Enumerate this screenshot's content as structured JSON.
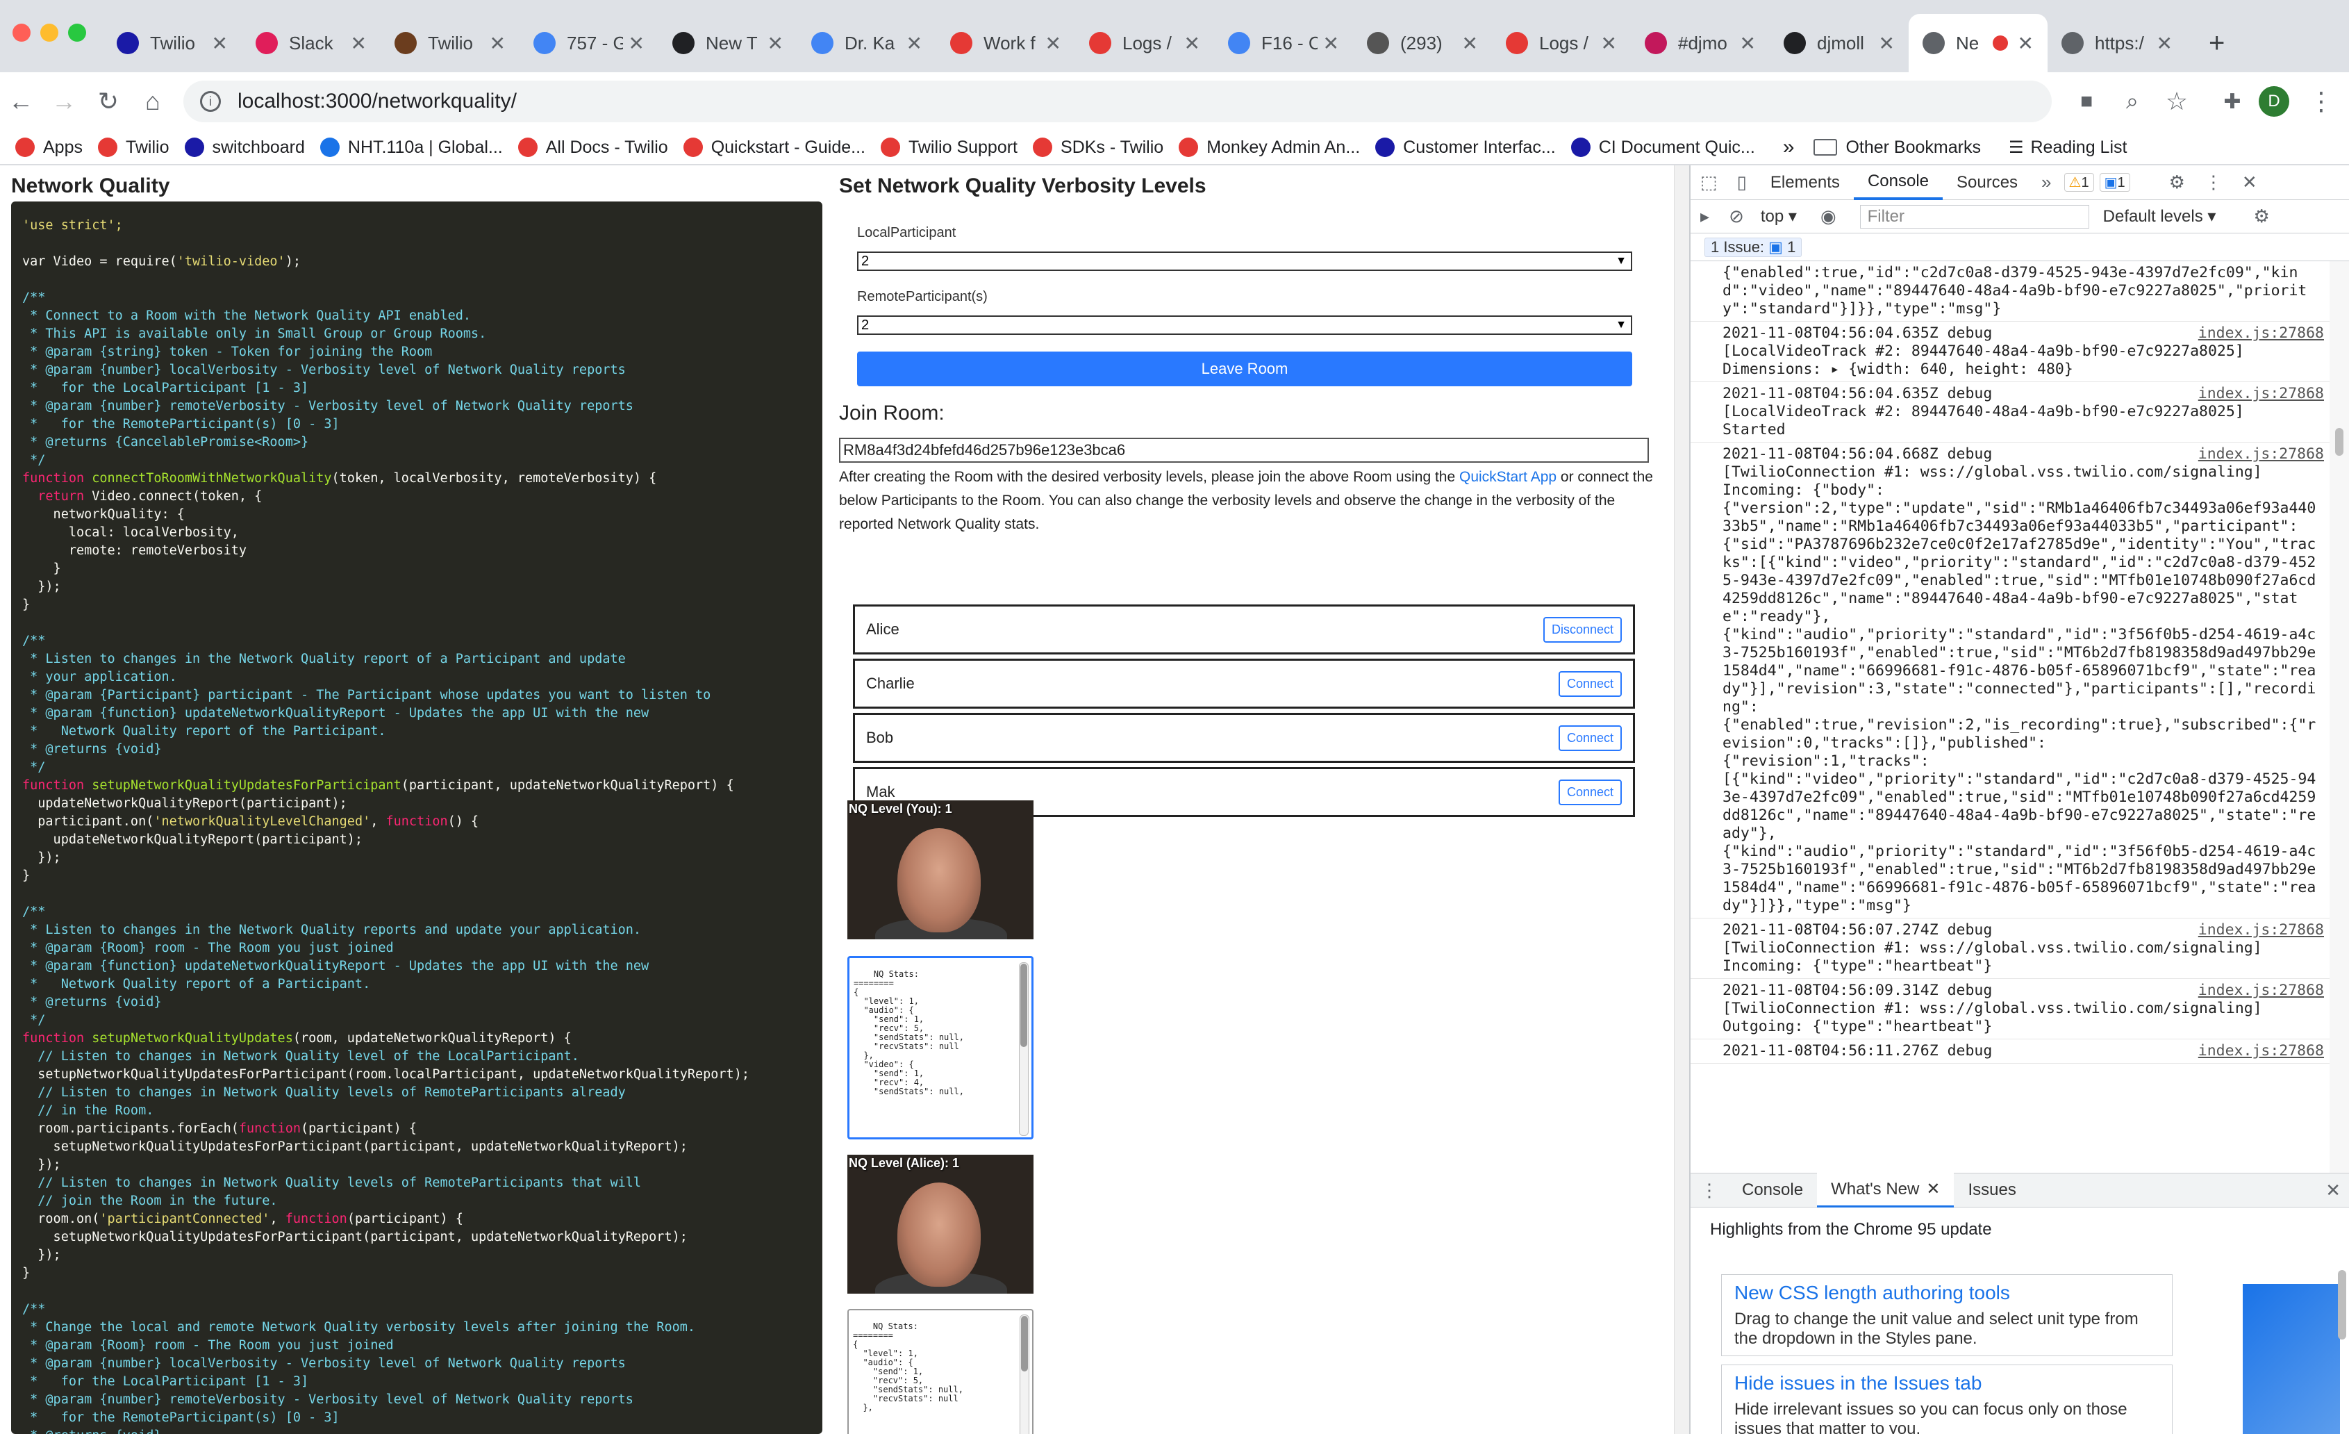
{
  "browser": {
    "tabs": [
      {
        "title": "Twilio",
        "color": "#1a1aa6"
      },
      {
        "title": "Slack",
        "color": "#e01e5a"
      },
      {
        "title": "Twilio",
        "color": "#6b3d1e"
      },
      {
        "title": "757 - G",
        "color": "#4285f4"
      },
      {
        "title": "New T",
        "color": "#202124"
      },
      {
        "title": "Dr. Ka",
        "color": "#4285f4"
      },
      {
        "title": "Work f",
        "color": "#e53935"
      },
      {
        "title": "Logs /",
        "color": "#e53935"
      },
      {
        "title": "F16 - C",
        "color": "#4285f4"
      },
      {
        "title": "(293)",
        "color": "#555"
      },
      {
        "title": "Logs /",
        "color": "#e53935"
      },
      {
        "title": "#djmo",
        "color": "#c2185b"
      },
      {
        "title": "djmoll",
        "color": "#202124"
      },
      {
        "title": "Ne",
        "color": "#5f6368",
        "active": true
      },
      {
        "title": "https:/",
        "color": "#5f6368"
      }
    ],
    "new_tab": "+",
    "url": "localhost:3000/networkquality/",
    "profile_initial": "D",
    "bookmarks": [
      {
        "label": "Apps",
        "color": "#e53935"
      },
      {
        "label": "Twilio",
        "color": "#e53935"
      },
      {
        "label": "switchboard",
        "color": "#1a1aa6"
      },
      {
        "label": "NHT.110a | Global...",
        "color": "#1a73e8"
      },
      {
        "label": "All Docs - Twilio",
        "color": "#e53935"
      },
      {
        "label": "Quickstart - Guide...",
        "color": "#e53935"
      },
      {
        "label": "Twilio Support",
        "color": "#e53935"
      },
      {
        "label": "SDKs - Twilio",
        "color": "#e53935"
      },
      {
        "label": "Monkey Admin An...",
        "color": "#e53935"
      },
      {
        "label": "Customer Interfac...",
        "color": "#1a1aa6"
      },
      {
        "label": "CI Document Quic...",
        "color": "#1a1aa6"
      }
    ],
    "overflow": "»",
    "other_bookmarks": "Other Bookmarks",
    "reading_list": "Reading List"
  },
  "page": {
    "title": "Network Quality",
    "code": [
      [
        {
          "t": "'use strict';",
          "c": "str"
        }
      ],
      [],
      [
        {
          "t": "var Video = require(",
          "c": ""
        },
        {
          "t": "'twilio-video'",
          "c": "str"
        },
        {
          "t": ");",
          "c": ""
        }
      ],
      [],
      [
        {
          "t": "/**",
          "c": "com"
        }
      ],
      [
        {
          "t": " * Connect to a Room with the Network Quality API enabled.",
          "c": "com"
        }
      ],
      [
        {
          "t": " * This API is available only in Small Group or Group Rooms.",
          "c": "com"
        }
      ],
      [
        {
          "t": " * @param {string} token - Token for joining the Room",
          "c": "com"
        }
      ],
      [
        {
          "t": " * @param {number} localVerbosity - Verbosity level of Network Quality reports",
          "c": "com"
        }
      ],
      [
        {
          "t": " *   for the LocalParticipant [1 - 3]",
          "c": "com"
        }
      ],
      [
        {
          "t": " * @param {number} remoteVerbosity - Verbosity level of Network Quality reports",
          "c": "com"
        }
      ],
      [
        {
          "t": " *   for the RemoteParticipant(s) [0 - 3]",
          "c": "com"
        }
      ],
      [
        {
          "t": " * @returns {CancelablePromise<Room>}",
          "c": "com"
        }
      ],
      [
        {
          "t": " */",
          "c": "com"
        }
      ],
      [
        {
          "t": "function ",
          "c": "kw"
        },
        {
          "t": "connectToRoomWithNetworkQuality",
          "c": "fn"
        },
        {
          "t": "(token, localVerbosity, remoteVerbosity) {",
          "c": ""
        }
      ],
      [
        {
          "t": "  return ",
          "c": "kw"
        },
        {
          "t": "Video.connect(token, {",
          "c": ""
        }
      ],
      [
        {
          "t": "    networkQuality: {",
          "c": ""
        }
      ],
      [
        {
          "t": "      local: localVerbosity,",
          "c": ""
        }
      ],
      [
        {
          "t": "      remote: remoteVerbosity",
          "c": ""
        }
      ],
      [
        {
          "t": "    }",
          "c": ""
        }
      ],
      [
        {
          "t": "  });",
          "c": ""
        }
      ],
      [
        {
          "t": "}",
          "c": ""
        }
      ],
      [],
      [
        {
          "t": "/**",
          "c": "com"
        }
      ],
      [
        {
          "t": " * Listen to changes in the Network Quality report of a Participant and update",
          "c": "com"
        }
      ],
      [
        {
          "t": " * your application.",
          "c": "com"
        }
      ],
      [
        {
          "t": " * @param {Participant} participant - The Participant whose updates you want to listen to",
          "c": "com"
        }
      ],
      [
        {
          "t": " * @param {function} updateNetworkQualityReport - Updates the app UI with the new",
          "c": "com"
        }
      ],
      [
        {
          "t": " *   Network Quality report of the Participant.",
          "c": "com"
        }
      ],
      [
        {
          "t": " * @returns {void}",
          "c": "com"
        }
      ],
      [
        {
          "t": " */",
          "c": "com"
        }
      ],
      [
        {
          "t": "function ",
          "c": "kw"
        },
        {
          "t": "setupNetworkQualityUpdatesForParticipant",
          "c": "fn"
        },
        {
          "t": "(participant, updateNetworkQualityReport) {",
          "c": ""
        }
      ],
      [
        {
          "t": "  updateNetworkQualityReport(participant);",
          "c": ""
        }
      ],
      [
        {
          "t": "  participant.on(",
          "c": ""
        },
        {
          "t": "'networkQualityLevelChanged'",
          "c": "str"
        },
        {
          "t": ", ",
          "c": ""
        },
        {
          "t": "function",
          "c": "kw"
        },
        {
          "t": "() {",
          "c": ""
        }
      ],
      [
        {
          "t": "    updateNetworkQualityReport(participant);",
          "c": ""
        }
      ],
      [
        {
          "t": "  });",
          "c": ""
        }
      ],
      [
        {
          "t": "}",
          "c": ""
        }
      ],
      [],
      [
        {
          "t": "/**",
          "c": "com"
        }
      ],
      [
        {
          "t": " * Listen to changes in the Network Quality reports and update your application.",
          "c": "com"
        }
      ],
      [
        {
          "t": " * @param {Room} room - The Room you just joined",
          "c": "com"
        }
      ],
      [
        {
          "t": " * @param {function} updateNetworkQualityReport - Updates the app UI with the new",
          "c": "com"
        }
      ],
      [
        {
          "t": " *   Network Quality report of a Participant.",
          "c": "com"
        }
      ],
      [
        {
          "t": " * @returns {void}",
          "c": "com"
        }
      ],
      [
        {
          "t": " */",
          "c": "com"
        }
      ],
      [
        {
          "t": "function ",
          "c": "kw"
        },
        {
          "t": "setupNetworkQualityUpdates",
          "c": "fn"
        },
        {
          "t": "(room, updateNetworkQualityReport) {",
          "c": ""
        }
      ],
      [
        {
          "t": "  // Listen to changes in Network Quality level of the LocalParticipant.",
          "c": "com"
        }
      ],
      [
        {
          "t": "  setupNetworkQualityUpdatesForParticipant(room.localParticipant, updateNetworkQualityReport);",
          "c": ""
        }
      ],
      [
        {
          "t": "  // Listen to changes in Network Quality levels of RemoteParticipants already",
          "c": "com"
        }
      ],
      [
        {
          "t": "  // in the Room.",
          "c": "com"
        }
      ],
      [
        {
          "t": "  room.participants.forEach(",
          "c": ""
        },
        {
          "t": "function",
          "c": "kw"
        },
        {
          "t": "(participant) {",
          "c": ""
        }
      ],
      [
        {
          "t": "    setupNetworkQualityUpdatesForParticipant(participant, updateNetworkQualityReport);",
          "c": ""
        }
      ],
      [
        {
          "t": "  });",
          "c": ""
        }
      ],
      [
        {
          "t": "  // Listen to changes in Network Quality levels of RemoteParticipants that will",
          "c": "com"
        }
      ],
      [
        {
          "t": "  // join the Room in the future.",
          "c": "com"
        }
      ],
      [
        {
          "t": "  room.on(",
          "c": ""
        },
        {
          "t": "'participantConnected'",
          "c": "str"
        },
        {
          "t": ", ",
          "c": ""
        },
        {
          "t": "function",
          "c": "kw"
        },
        {
          "t": "(participant) {",
          "c": ""
        }
      ],
      [
        {
          "t": "    setupNetworkQualityUpdatesForParticipant(participant, updateNetworkQualityReport);",
          "c": ""
        }
      ],
      [
        {
          "t": "  });",
          "c": ""
        }
      ],
      [
        {
          "t": "}",
          "c": ""
        }
      ],
      [],
      [
        {
          "t": "/**",
          "c": "com"
        }
      ],
      [
        {
          "t": " * Change the local and remote Network Quality verbosity levels after joining the Room.",
          "c": "com"
        }
      ],
      [
        {
          "t": " * @param {Room} room - The Room you just joined",
          "c": "com"
        }
      ],
      [
        {
          "t": " * @param {number} localVerbosity - Verbosity level of Network Quality reports",
          "c": "com"
        }
      ],
      [
        {
          "t": " *   for the LocalParticipant [1 - 3]",
          "c": "com"
        }
      ],
      [
        {
          "t": " * @param {number} remoteVerbosity - Verbosity level of Network Quality reports",
          "c": "com"
        }
      ],
      [
        {
          "t": " *   for the RemoteParticipant(s) [0 - 3]",
          "c": "com"
        }
      ],
      [
        {
          "t": " * @returns {void}",
          "c": "com"
        }
      ]
    ],
    "verbosity": {
      "title": "Set Network Quality Verbosity Levels",
      "local_label": "LocalParticipant",
      "local_value": "2",
      "remote_label": "RemoteParticipant(s)",
      "remote_value": "2",
      "leave_button": "Leave Room"
    },
    "join": {
      "title": "Join Room:",
      "room_sid": "RM8a4f3d24bfefd46d257b96e123e3bca6",
      "desc_1": "After creating the Room with the desired verbosity levels, please join the above Room using the ",
      "desc_link": "QuickStart App",
      "desc_2": " or connect the below Participants to the Room. You can also change the verbosity levels and observe the change in the verbosity of the reported Network Quality stats."
    },
    "participants": [
      {
        "name": "Alice",
        "button": "Disconnect"
      },
      {
        "name": "Charlie",
        "button": "Connect"
      },
      {
        "name": "Bob",
        "button": "Connect"
      },
      {
        "name": "Mak",
        "button": "Connect"
      }
    ],
    "videos": [
      {
        "label": "NQ Level (You): 1"
      },
      {
        "label": "NQ Level (Alice): 1"
      }
    ],
    "stats": [
      "NQ Stats:\n========\n{\n  \"level\": 1,\n  \"audio\": {\n    \"send\": 1,\n    \"recv\": 5,\n    \"sendStats\": null,\n    \"recvStats\": null\n  },\n  \"video\": {\n    \"send\": 1,\n    \"recv\": 4,\n    \"sendStats\": null,",
      "NQ Stats:\n========\n{\n  \"level\": 1,\n  \"audio\": {\n    \"send\": 1,\n    \"recv\": 5,\n    \"sendStats\": null,\n    \"recvStats\": null\n  },"
    ]
  },
  "devtools": {
    "tabs": [
      "Elements",
      "Console",
      "Sources"
    ],
    "more": "»",
    "warn_count": "1",
    "info_count": "1",
    "context": "top",
    "filter_placeholder": "Filter",
    "levels": "Default levels",
    "issues_label": "1 Issue:",
    "issues_count": "1",
    "logs": [
      {
        "lines": [
          "{\"enabled\":true,\"id\":\"c2d7c0a8-d379-4525-943e-4397d7e2fc09\",\"kind\":\"video\",\"name\":\"89447640-48a4-4a9b-bf90-e7c9227a8025\",\"priority\":\"standard\"}]}},\"type\":\"msg\"}"
        ]
      },
      {
        "src": "index.js:27868",
        "lines": [
          "2021-11-08T04:56:04.635Z debug",
          "[LocalVideoTrack #2: 89447640-48a4-4a9b-bf90-e7c9227a8025]",
          "Dimensions: ▸ {width: 640, height: 480}"
        ]
      },
      {
        "src": "index.js:27868",
        "lines": [
          "2021-11-08T04:56:04.635Z debug",
          "[LocalVideoTrack #2: 89447640-48a4-4a9b-bf90-e7c9227a8025]",
          "Started"
        ]
      },
      {
        "src": "index.js:27868",
        "lines": [
          "2021-11-08T04:56:04.668Z debug",
          "[TwilioConnection #1: wss://global.vss.twilio.com/signaling]",
          "Incoming: {\"body\":",
          "{\"version\":2,\"type\":\"update\",\"sid\":\"RMb1a46406fb7c34493a06ef93a44033b5\",\"name\":\"RMb1a46406fb7c34493a06ef93a44033b5\",\"participant\":",
          "{\"sid\":\"PA3787696b232e7ce0c0f2e17af2785d9e\",\"identity\":\"You\",\"tracks\":[{\"kind\":\"video\",\"priority\":\"standard\",\"id\":\"c2d7c0a8-d379-4525-943e-4397d7e2fc09\",\"enabled\":true,\"sid\":\"MTfb01e10748b090f27a6cd4259dd8126c\",\"name\":\"89447640-48a4-4a9b-bf90-e7c9227a8025\",\"state\":\"ready\"},",
          "{\"kind\":\"audio\",\"priority\":\"standard\",\"id\":\"3f56f0b5-d254-4619-a4c3-7525b160193f\",\"enabled\":true,\"sid\":\"MT6b2d7fb8198358d9ad497bb29e1584d4\",\"name\":\"66996681-f91c-4876-b05f-65896071bcf9\",\"state\":\"ready\"}],\"revision\":3,\"state\":\"connected\"},\"participants\":[],\"recording\":",
          "{\"enabled\":true,\"revision\":2,\"is_recording\":true},\"subscribed\":{\"revision\":0,\"tracks\":[]},\"published\":",
          "{\"revision\":1,\"tracks\":",
          "[{\"kind\":\"video\",\"priority\":\"standard\",\"id\":\"c2d7c0a8-d379-4525-943e-4397d7e2fc09\",\"enabled\":true,\"sid\":\"MTfb01e10748b090f27a6cd4259dd8126c\",\"name\":\"89447640-48a4-4a9b-bf90-e7c9227a8025\",\"state\":\"ready\"},",
          "{\"kind\":\"audio\",\"priority\":\"standard\",\"id\":\"3f56f0b5-d254-4619-a4c3-7525b160193f\",\"enabled\":true,\"sid\":\"MT6b2d7fb8198358d9ad497bb29e1584d4\",\"name\":\"66996681-f91c-4876-b05f-65896071bcf9\",\"state\":\"ready\"}]}},\"type\":\"msg\"}"
        ]
      },
      {
        "src": "index.js:27868",
        "lines": [
          "2021-11-08T04:56:07.274Z debug",
          "[TwilioConnection #1: wss://global.vss.twilio.com/signaling]",
          "Incoming: {\"type\":\"heartbeat\"}"
        ]
      },
      {
        "src": "index.js:27868",
        "lines": [
          "2021-11-08T04:56:09.314Z debug",
          "[TwilioConnection #1: wss://global.vss.twilio.com/signaling]",
          "Outgoing: {\"type\":\"heartbeat\"}"
        ]
      },
      {
        "src": "index.js:27868",
        "lines": [
          "2021-11-08T04:56:11.276Z debug"
        ]
      }
    ],
    "drawer_tabs": [
      "Console",
      "What's New",
      "Issues"
    ],
    "whats_new_head": "Highlights from the Chrome 95 update",
    "cards": [
      {
        "title": "New CSS length authoring tools",
        "body": "Drag to change the unit value and select unit type from the dropdown in the Styles pane."
      },
      {
        "title": "Hide issues in the Issues tab",
        "body": "Hide irrelevant issues so you can focus only on those issues that matter to you."
      }
    ]
  }
}
